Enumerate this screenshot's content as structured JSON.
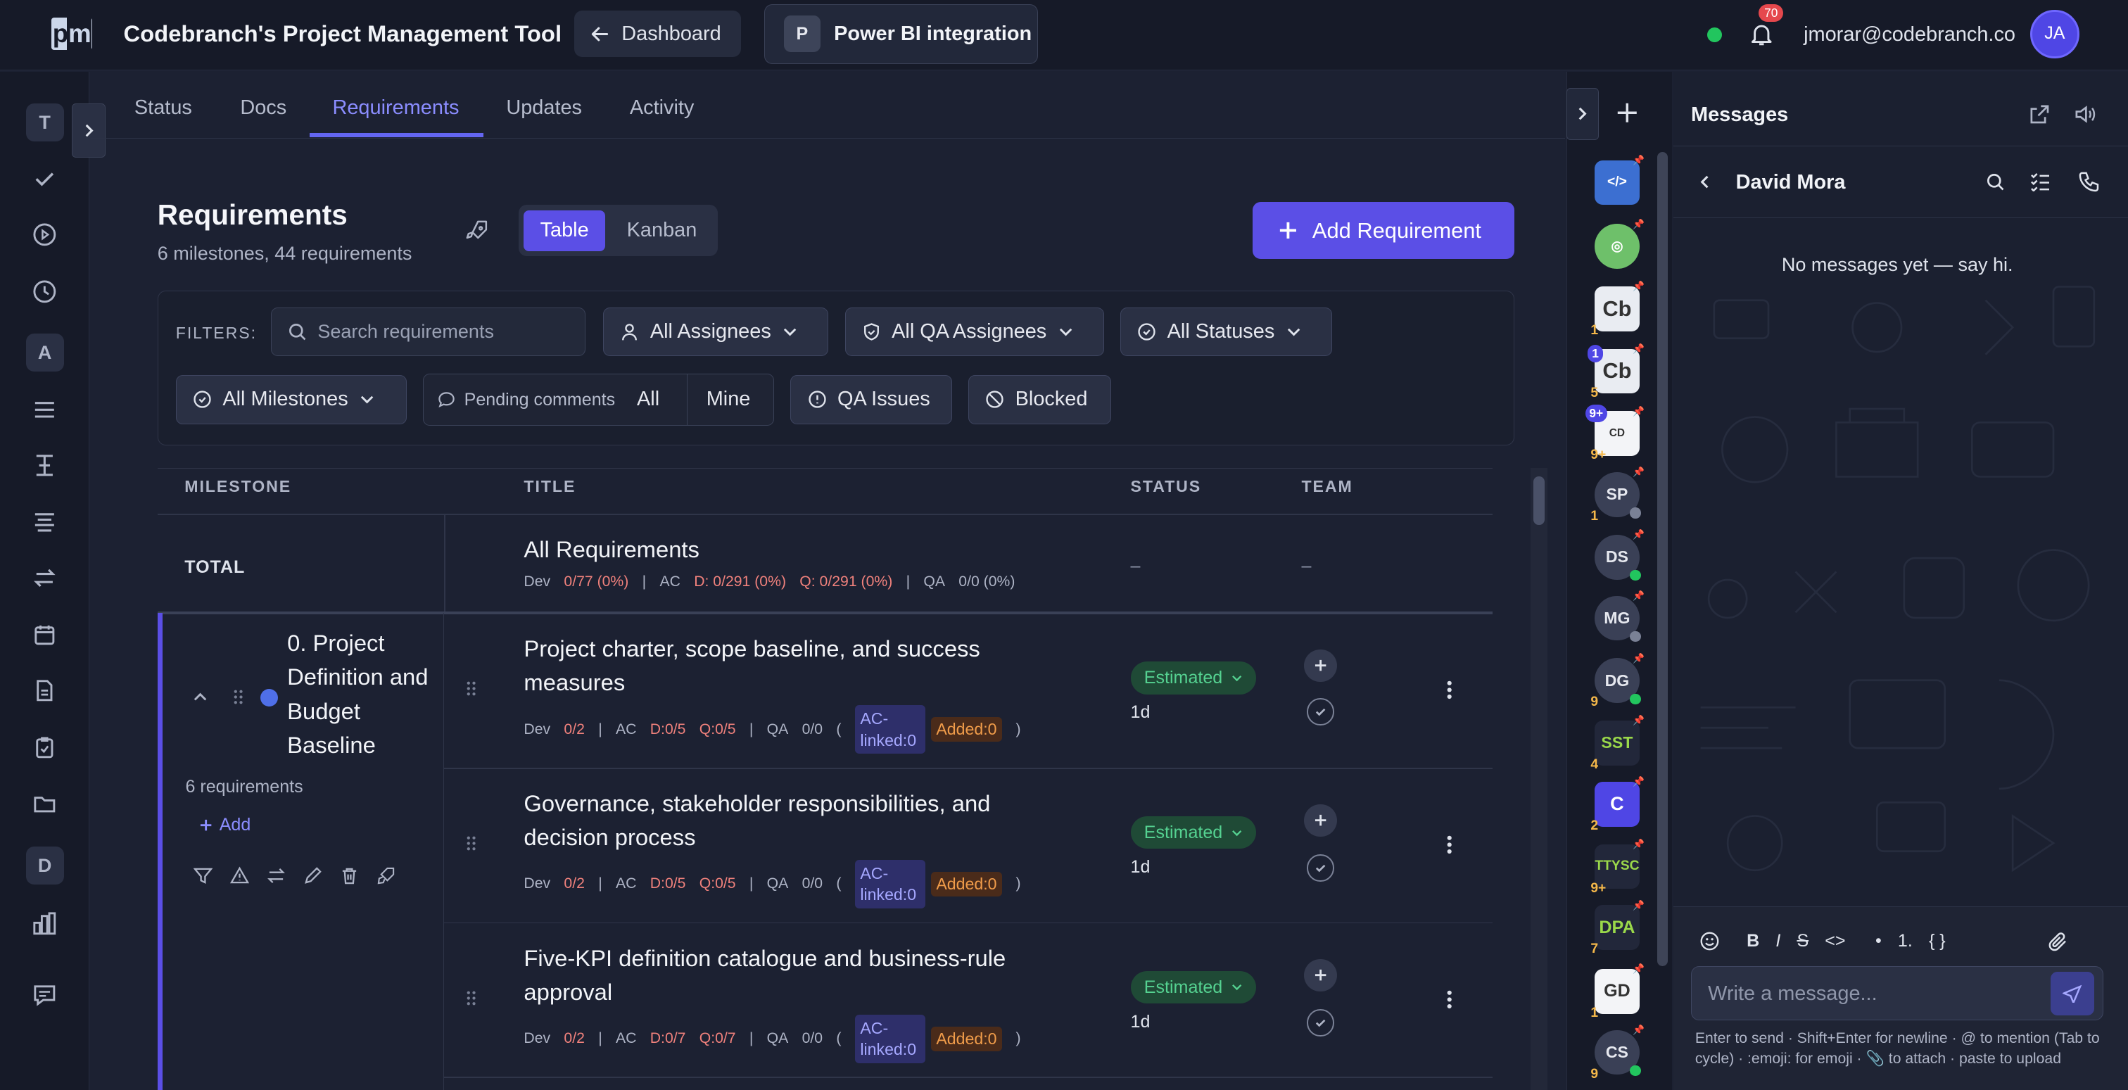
{
  "app": {
    "title": "Codebranch's Project Management Tool",
    "logo_text": "pm"
  },
  "topbar": {
    "dashboard_label": "Dashboard",
    "project_initial": "P",
    "project_name": "Power BI integration",
    "notifications_count": "70",
    "user_email": "jmorar@codebranch.co",
    "user_initials": "JA"
  },
  "leftrail": {
    "letters": [
      "T",
      "A",
      "D"
    ]
  },
  "tabs": [
    "Status",
    "Docs",
    "Requirements",
    "Updates",
    "Activity"
  ],
  "requirements": {
    "title": "Requirements",
    "subtitle": "6 milestones, 44 requirements",
    "view_table": "Table",
    "view_kanban": "Kanban",
    "add_label": "Add Requirement"
  },
  "filters": {
    "label": "FILTERS:",
    "search_placeholder": "Search requirements",
    "assignees": "All Assignees",
    "qa_assignees": "All QA Assignees",
    "statuses": "All Statuses",
    "milestones": "All Milestones",
    "pending_label": "Pending comments",
    "pending_all": "All",
    "pending_mine": "Mine",
    "qa_issues": "QA Issues",
    "blocked": "Blocked"
  },
  "table": {
    "headers": [
      "MILESTONE",
      "TITLE",
      "STATUS",
      "TEAM"
    ],
    "total": {
      "label": "TOTAL",
      "title": "All Requirements",
      "dev_label": "Dev",
      "dev_value": "0/77 (0%)",
      "ac_label": "AC",
      "ac_d": "D: 0/291 (0%)",
      "ac_q": "Q: 0/291 (0%)",
      "qa_label": "QA",
      "qa_value": "0/0 (0%)",
      "status": "–",
      "team": "–"
    },
    "milestone": {
      "name": "0. Project Definition and Budget Baseline",
      "count": "6 requirements",
      "add_label": "Add"
    },
    "rows": [
      {
        "title": "Project charter, scope baseline, and success measures",
        "dev": "0/2",
        "ac_d": "D:0/5",
        "ac_q": "Q:0/5",
        "qa": "0/0",
        "ac_linked": "AC-linked:0",
        "added": "Added:0",
        "status": "Estimated",
        "days": "1d"
      },
      {
        "title": "Governance, stakeholder responsibilities, and decision process",
        "dev": "0/2",
        "ac_d": "D:0/5",
        "ac_q": "Q:0/5",
        "qa": "0/0",
        "ac_linked": "AC-linked:0",
        "added": "Added:0",
        "status": "Estimated",
        "days": "1d"
      },
      {
        "title": "Five-KPI definition catalogue and business-rule approval",
        "dev": "0/2",
        "ac_d": "D:0/7",
        "ac_q": "Q:0/7",
        "qa": "0/0",
        "ac_linked": "AC-linked:0",
        "added": "Added:0",
        "status": "Estimated",
        "days": "1d"
      }
    ],
    "labels": {
      "dev": "Dev",
      "ac": "AC",
      "qa": "QA",
      "sep": "|",
      "open": "(",
      "close": ")"
    }
  },
  "rightrail": {
    "items": [
      {
        "label": "",
        "badge": ""
      },
      {
        "label": "",
        "badge": ""
      },
      {
        "label": "",
        "badge": "1"
      },
      {
        "label": "",
        "badge": "5"
      },
      {
        "label": "",
        "badge": "9+"
      },
      {
        "label": "SP",
        "badge": "1"
      },
      {
        "label": "DS",
        "badge": ""
      },
      {
        "label": "MG",
        "badge": ""
      },
      {
        "label": "DG",
        "badge": "9"
      },
      {
        "label": "SST",
        "badge": "4"
      },
      {
        "label": "C",
        "badge": "2"
      },
      {
        "label": "TTYSC",
        "badge": "9+"
      },
      {
        "label": "DPA",
        "badge": "7"
      },
      {
        "label": "",
        "badge": "1"
      },
      {
        "label": "CS",
        "badge": "9"
      }
    ],
    "top_badges": [
      "1",
      "9+"
    ]
  },
  "messages": {
    "title": "Messages",
    "contact": "David Mora",
    "empty": "No messages yet — say hi.",
    "placeholder": "Write a message...",
    "hint": "Enter to send · Shift+Enter for newline · @ to mention (Tab to cycle) · :emoji: for emoji · 📎 to attach · paste to upload",
    "format": [
      "B",
      "I",
      "S",
      "<>",
      "•",
      "1.",
      "{ }"
    ]
  }
}
